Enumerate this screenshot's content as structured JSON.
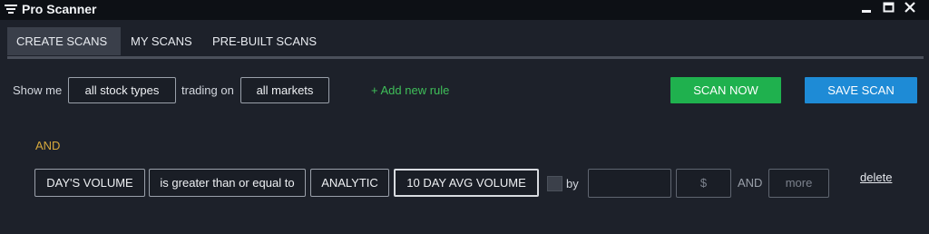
{
  "window": {
    "title": "Pro Scanner",
    "icons": {
      "app": "filter-icon",
      "minimize": "minimize-icon",
      "maximize": "maximize-icon",
      "close": "close-icon"
    }
  },
  "tabs": [
    {
      "label": "CREATE SCANS",
      "active": true
    },
    {
      "label": "MY SCANS",
      "active": false
    },
    {
      "label": "PRE-BUILT SCANS",
      "active": false
    }
  ],
  "filter_row": {
    "show_me_label": "Show me",
    "stock_types": "all stock types",
    "trading_on_label": "trading on",
    "markets": "all markets",
    "add_rule": "+ Add new rule",
    "scan_now": "SCAN NOW",
    "save_scan": "SAVE SCAN"
  },
  "rule": {
    "conjunction": "AND",
    "field": "DAY'S VOLUME",
    "operator": "is greater than or equal to",
    "compare_type": "ANALYTIC",
    "compare_value": "10 DAY AVG VOLUME",
    "by_label": "by",
    "amount_value": "",
    "unit_placeholder": "$",
    "and_label": "AND",
    "more_placeholder": "more",
    "delete": "delete"
  },
  "colors": {
    "accent_green": "#1fb14e",
    "accent_blue": "#1e8bd6",
    "add_rule_green": "#3fbf59",
    "and_gold": "#d7a93d"
  }
}
